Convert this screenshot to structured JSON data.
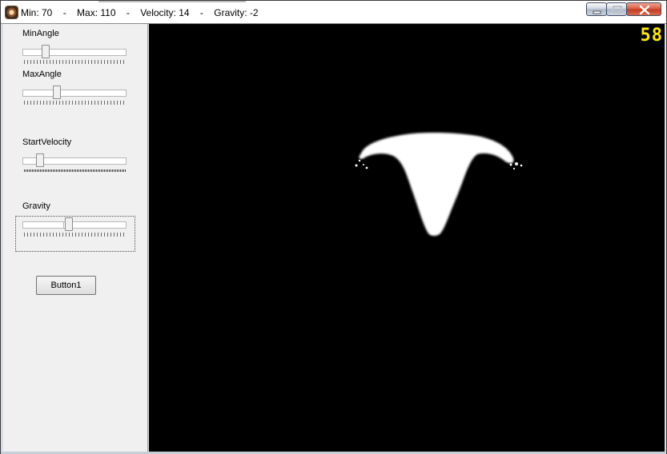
{
  "window": {
    "title": {
      "min": "Min: 70",
      "sep1": "-",
      "max": "Max: 110",
      "sep2": "-",
      "velocity": "Velocity: 14",
      "sep3": "-",
      "gravity": "Gravity: -2"
    },
    "caption_buttons": [
      "minimize-icon",
      "maximize-icon",
      "close-icon"
    ]
  },
  "panel": {
    "min_angle": {
      "label": "MinAngle",
      "value_fraction": 0.2
    },
    "max_angle": {
      "label": "MaxAngle",
      "value_fraction": 0.32
    },
    "start_velocity": {
      "label": "StartVelocity",
      "value_fraction": 0.14
    },
    "gravity": {
      "label": "Gravity",
      "value_fraction": 0.44
    },
    "button1": {
      "label": "Button1"
    }
  },
  "canvas": {
    "fps": "58",
    "background": "#000000",
    "particle_color": "#ffffff",
    "fps_color": "#ffea00"
  }
}
